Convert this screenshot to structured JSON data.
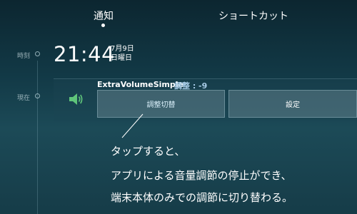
{
  "tabs": [
    {
      "label": "通知",
      "active": true
    },
    {
      "label": "ショートカット",
      "active": false
    }
  ],
  "timeline": {
    "time_label": "時刻",
    "current_label": "現在"
  },
  "clock": {
    "time": "21:44",
    "date": "7月9日",
    "weekday": "日曜日"
  },
  "notification": {
    "app_name": "ExtraVolumeSimple",
    "adjust_status": "調整 : -9",
    "icon": "speaker-volume-icon",
    "buttons": {
      "adjust": "調整切替",
      "settings": "設定"
    }
  },
  "caption": {
    "line1": "タップすると、",
    "line2": "アプリによる音量調節の停止ができ、",
    "line3": "端末本体のみでの調節に切り替わる。"
  },
  "colors": {
    "accent_text": "#a9cde8",
    "icon_green": "#5fc47a"
  }
}
